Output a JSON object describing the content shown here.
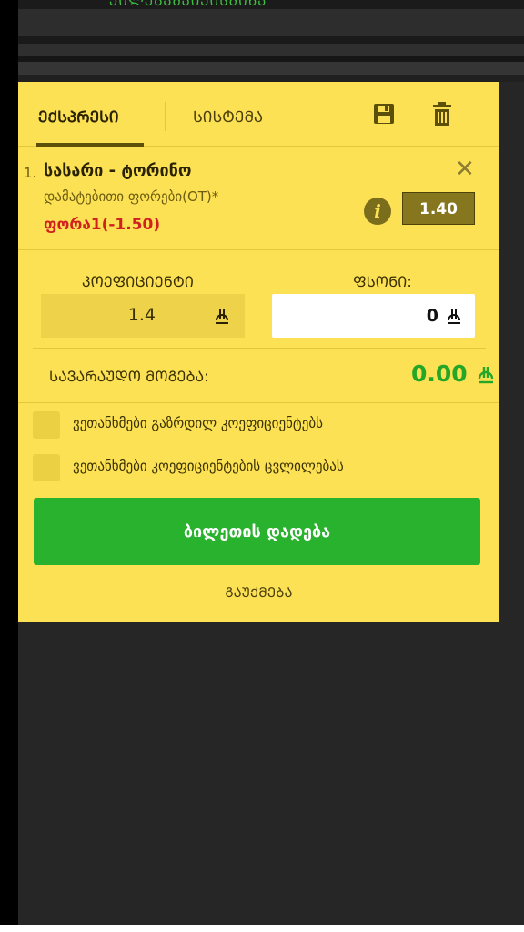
{
  "header": {
    "partial_text": "ᲔᲘᲚᲔᲒᲐᲛᲐᲘᲔᲘᲡᲛᲘᲜᲐ"
  },
  "tabs": [
    {
      "label": "ᲔᲥᲡᲞᲠᲔᲡᲘ",
      "active": true
    },
    {
      "label": "ᲡᲘᲡᲢᲔᲛᲐ",
      "active": false
    }
  ],
  "toolbar": {
    "save_icon": "floppy-disk-icon",
    "delete_icon": "trash-icon"
  },
  "bet": {
    "number": "1.",
    "title": "სასარი - ტორინო",
    "market": "დამატებითი ფორები(OT)*",
    "pick": "ფორა1(-1.50)",
    "odds": "1.40"
  },
  "coefficient": {
    "label": "ᲙᲝᲔᲤᲘᲪᲘᲔᲜᲢᲘ",
    "value": "1.4"
  },
  "stake": {
    "label": "ᲤᲡᲝᲜᲘ:",
    "value": "0"
  },
  "possible_win": {
    "label": "ᲡᲐᲕᲐᲠᲐᲣᲓᲝ ᲛᲝᲒᲔᲑᲐ:",
    "value": "0.00"
  },
  "options": [
    {
      "label": "ვეთანხმები გაზრდილ კოეფიციენტებს",
      "checked": false
    },
    {
      "label": "ვეთანხმები კოეფიციენტების ცვლილებას",
      "checked": false
    }
  ],
  "actions": {
    "place_bet": "ბილეთის დადება",
    "cancel": "ᲒᲐᲣᲥᲛᲔᲑᲐ"
  },
  "colors": {
    "panel": "#fce154",
    "accent_green": "#28b22d",
    "pick_red": "#d02020",
    "odds_badge": "#86761d"
  }
}
